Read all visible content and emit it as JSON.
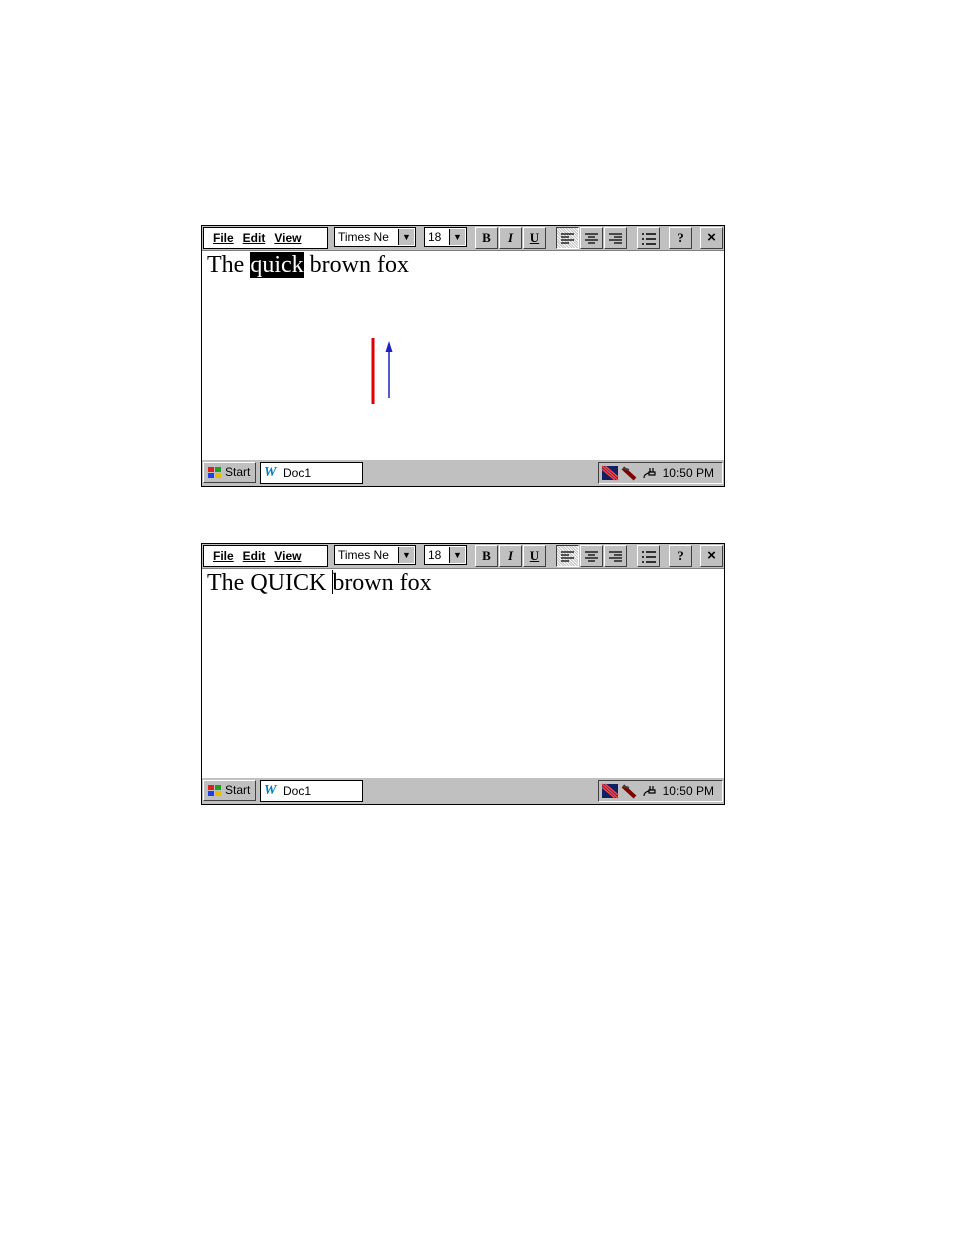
{
  "screens": [
    {
      "menu": {
        "file": "File",
        "edit": "Edit",
        "view": "View"
      },
      "font": "Times Ne",
      "size": "18",
      "document": {
        "before": "The ",
        "selected": "quick",
        "after": " brown fox"
      },
      "taskbar": {
        "start": "Start",
        "task": "Doc1",
        "clock": "10:50 PM"
      }
    },
    {
      "menu": {
        "file": "File",
        "edit": "Edit",
        "view": "View"
      },
      "font": "Times Ne",
      "size": "18",
      "document": {
        "before": "The QUICK ",
        "after": "brown fox"
      },
      "taskbar": {
        "start": "Start",
        "task": "Doc1",
        "clock": "10:50 PM"
      }
    }
  ],
  "toolbar_buttons": {
    "bold": "B",
    "italic": "I",
    "underline": "U",
    "help": "?",
    "close": "×"
  },
  "gesture": {
    "stroke_color": "#e00000",
    "arrow_color": "#2020c0"
  },
  "colors": {
    "chrome": "#c0c0c0",
    "selection": "#000000",
    "accent": "#0080c0"
  }
}
